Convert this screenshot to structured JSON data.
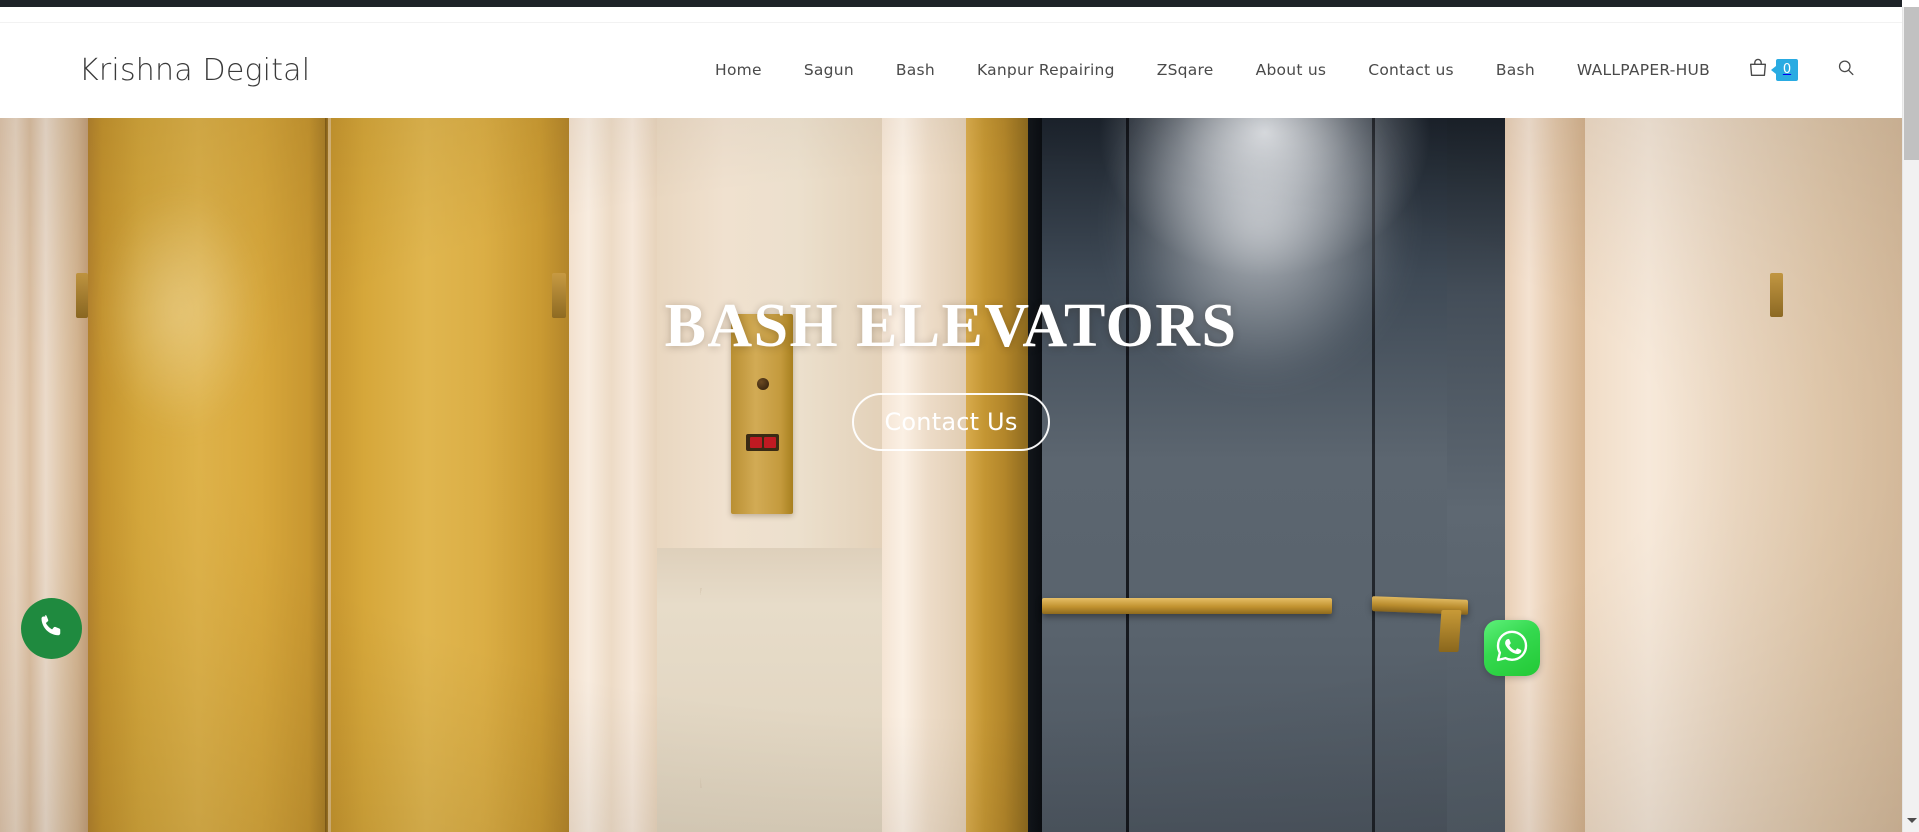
{
  "browser": {
    "scrollbar": {
      "thumb_position": "top",
      "down_arrow_icon": "chevron-down-icon"
    }
  },
  "header": {
    "logo_text": "Krishna Degital",
    "nav_items": [
      {
        "label": "Home"
      },
      {
        "label": "Sagun"
      },
      {
        "label": "Bash"
      },
      {
        "label": "Kanpur Repairing"
      },
      {
        "label": "ZSqare"
      },
      {
        "label": "About us"
      },
      {
        "label": "Contact us"
      },
      {
        "label": "Bash"
      },
      {
        "label": "WALLPAPER-HUB"
      }
    ],
    "cart": {
      "icon": "shopping-bag-icon",
      "count": "0",
      "badge_color": "#29abe2"
    },
    "search": {
      "icon": "search-icon"
    }
  },
  "hero": {
    "title": "BASH ELEVATORS",
    "cta_label": "Contact Us",
    "image_description": "Gold brass elevator doors on the left, cream marble lobby wall with brass call panel in the centre, dark steel elevator with gold handrails on the right"
  },
  "floating_actions": {
    "call": {
      "icon": "phone-icon",
      "color": "#1f8a3f",
      "label": "Call"
    },
    "whatsapp": {
      "icon": "whatsapp-icon",
      "color": "#23c936",
      "label": "WhatsApp"
    }
  }
}
